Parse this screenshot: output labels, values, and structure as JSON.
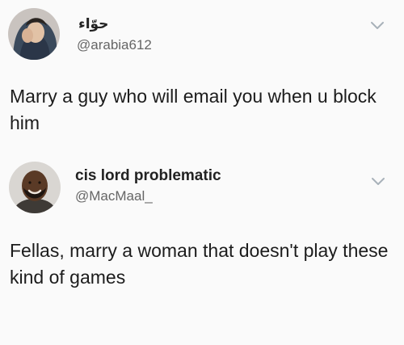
{
  "tweets": [
    {
      "display_name": "حوّاء",
      "handle": "@arabia612",
      "text": "Marry a guy who will email you when u block him",
      "avatar_icon": "user-avatar",
      "menu_icon": "chevron-down-icon"
    },
    {
      "display_name": "cis lord problematic",
      "handle": "@MacMaal_",
      "text": "Fellas, marry a woman that doesn't play these kind of games",
      "avatar_icon": "user-avatar",
      "menu_icon": "chevron-down-icon"
    }
  ],
  "colors": {
    "background": "#fafafa",
    "text": "#1c1c1c",
    "handle": "#666666",
    "chevron": "#a8b1b9"
  }
}
